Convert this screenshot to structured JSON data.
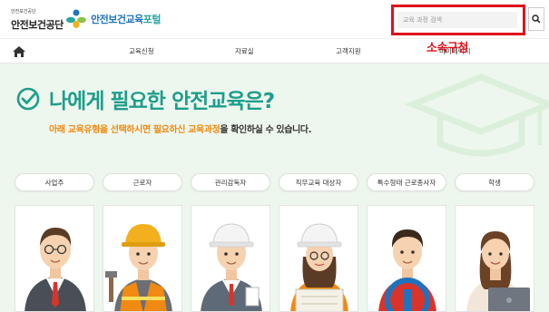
{
  "header": {
    "org_small": "안전보건공단",
    "org_name": "안전보건공단",
    "portal_main": "안전보건교육",
    "portal_accent": "포털",
    "search": {
      "placeholder": "교육 과정 검색"
    }
  },
  "nav": {
    "items": [
      {
        "label": "교육신청"
      },
      {
        "label": "자료실"
      },
      {
        "label": "고객지원"
      },
      {
        "label": "마이페이지"
      }
    ]
  },
  "annotation": {
    "text": "소속구청",
    "color": "#e0101a"
  },
  "hero": {
    "title": "나에게 필요한 안전교육은?",
    "sub_before": "아래 ",
    "sub_hl1": "교육유형",
    "sub_mid": "을 선택하시면 필요하신 ",
    "sub_hl2": "교육과정",
    "sub_after": "을 확인하실 수 있습니다."
  },
  "categories": [
    {
      "label": "사업주",
      "icon": "employer-avatar"
    },
    {
      "label": "근로자",
      "icon": "worker-avatar"
    },
    {
      "label": "관리감독자",
      "icon": "supervisor-avatar"
    },
    {
      "label": "직무교육 대상자",
      "icon": "job-training-avatar"
    },
    {
      "label": "특수형태 근로종사자",
      "icon": "special-worker-avatar"
    },
    {
      "label": "학생",
      "icon": "student-avatar"
    }
  ],
  "colors": {
    "brand_teal": "#1e9e8c",
    "brand_blue": "#1e73be",
    "highlight_orange": "#f08a12",
    "hero_bg": "#eef7ee"
  }
}
